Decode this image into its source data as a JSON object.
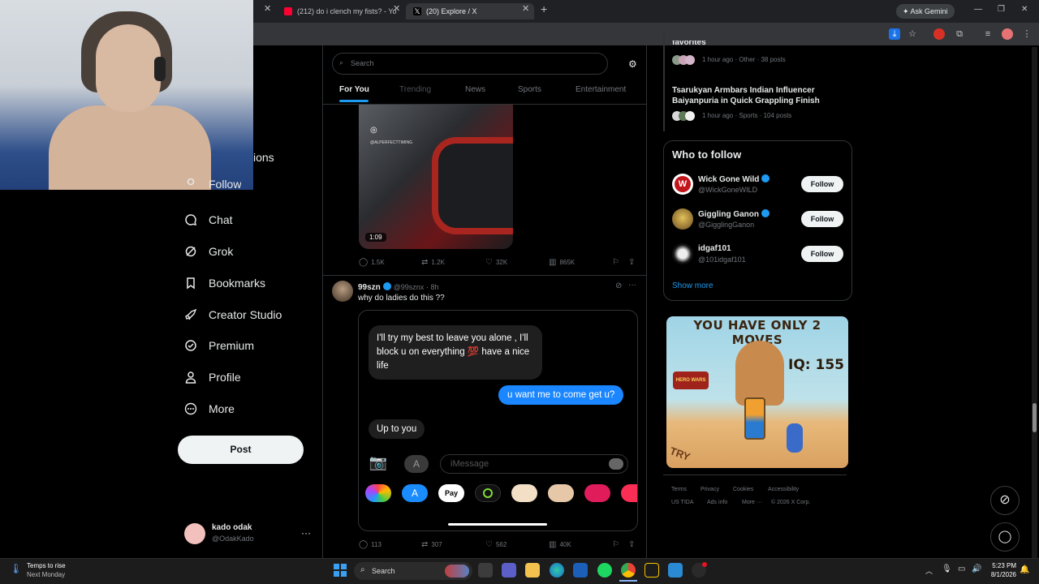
{
  "browser": {
    "tabs": [
      {
        "title": "(212) do i clench my fists? - Yo"
      },
      {
        "title": "(20) Explore / X"
      }
    ],
    "ask_gemini": "Ask Gemini"
  },
  "nav": {
    "items": [
      {
        "label": "ions"
      },
      {
        "label": "Follow"
      },
      {
        "label": "Chat"
      },
      {
        "label": "Grok"
      },
      {
        "label": "Bookmarks"
      },
      {
        "label": "Creator Studio"
      },
      {
        "label": "Premium"
      },
      {
        "label": "Profile"
      },
      {
        "label": "More"
      }
    ],
    "post_label": "Post",
    "account": {
      "name": "kado odak",
      "handle": "@OdakKado"
    }
  },
  "main": {
    "search_placeholder": "Search",
    "tabs": [
      "For You",
      "Trending",
      "News",
      "Sports",
      "Entertainment"
    ],
    "tweet1": {
      "duration": "1:09",
      "watermark": "@ALPERFECTTIMING",
      "stats": {
        "replies": "1.5K",
        "retweets": "1.2K",
        "likes": "32K",
        "views": "865K"
      }
    },
    "tweet2": {
      "name": "99szn",
      "handle": "@99sznx",
      "time": "· 8h",
      "text": "why do ladies do this ??",
      "messages": {
        "received1": "I'll try my best to leave you alone , I'll block u on everything 💯 have a nice life",
        "sent1": "u want me to come get u?",
        "received2": "Up to you",
        "input_placeholder": "iMessage",
        "apple_pay": "Pay"
      },
      "stats": {
        "replies": "113",
        "retweets": "307",
        "likes": "562",
        "views": "40K"
      }
    }
  },
  "sidebar": {
    "trending": [
      {
        "title": "favorites",
        "meta": "1 hour ago · Other · 38 posts"
      },
      {
        "title": "Tsarukyan Armbars Indian Influencer Baiyanpuria in Quick Grappling Finish",
        "meta": "1 hour ago · Sports · 104 posts"
      }
    ],
    "who_to_follow": {
      "heading": "Who to follow",
      "users": [
        {
          "name": "Wick Gone Wild",
          "handle": "@WickGoneWILD",
          "button": "Follow"
        },
        {
          "name": "Giggling Ganon",
          "handle": "@GigglingGanon",
          "button": "Follow"
        },
        {
          "name": "idgaf101",
          "handle": "@101idgaf101",
          "button": "Follow"
        }
      ],
      "show_more": "Show more"
    },
    "ad": {
      "headline": "YOU HAVE ONLY 2 MOVES",
      "iq": "IQ: 155",
      "try": "TRY",
      "logo": "HERO WARS"
    },
    "footer": [
      "Terms",
      "Privacy",
      "Cookies",
      "Accessibility",
      "US TIDA",
      "Ads info",
      "More ···",
      "© 2026 X Corp."
    ]
  },
  "taskbar": {
    "weather_title": "Temps to rise",
    "weather_sub": "Next Monday",
    "search": "Search",
    "time": "5:23 PM",
    "date": "8/1/2026"
  }
}
